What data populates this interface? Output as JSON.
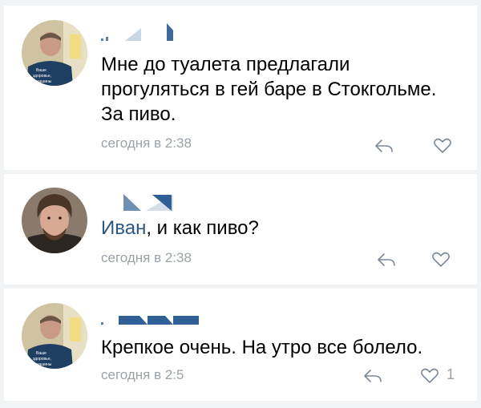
{
  "comments": [
    {
      "author": "",
      "text": "Мне до туалета предлагали прогуляться в гей баре в Стокгольме. За пиво.",
      "timestamp": "сегодня в 2:38",
      "avatar": "photo-man-hoodie"
    },
    {
      "author": "",
      "mention": "Иван",
      "text_rest": ", и как пиво?",
      "timestamp": "сегодня в 2:38",
      "avatar": "photo-bearded-man"
    },
    {
      "author": "",
      "text": "Крепкое очень. На утро все болело.",
      "timestamp": "сегодня в 2:5",
      "like_count": "1",
      "avatar": "photo-man-hoodie"
    }
  ],
  "icons": {
    "reply": "reply-arrow-icon",
    "like": "heart-outline-icon"
  },
  "colors": {
    "mention": "#2a5885",
    "meta": "#9aa1a9",
    "background": "#f2f3f5"
  }
}
